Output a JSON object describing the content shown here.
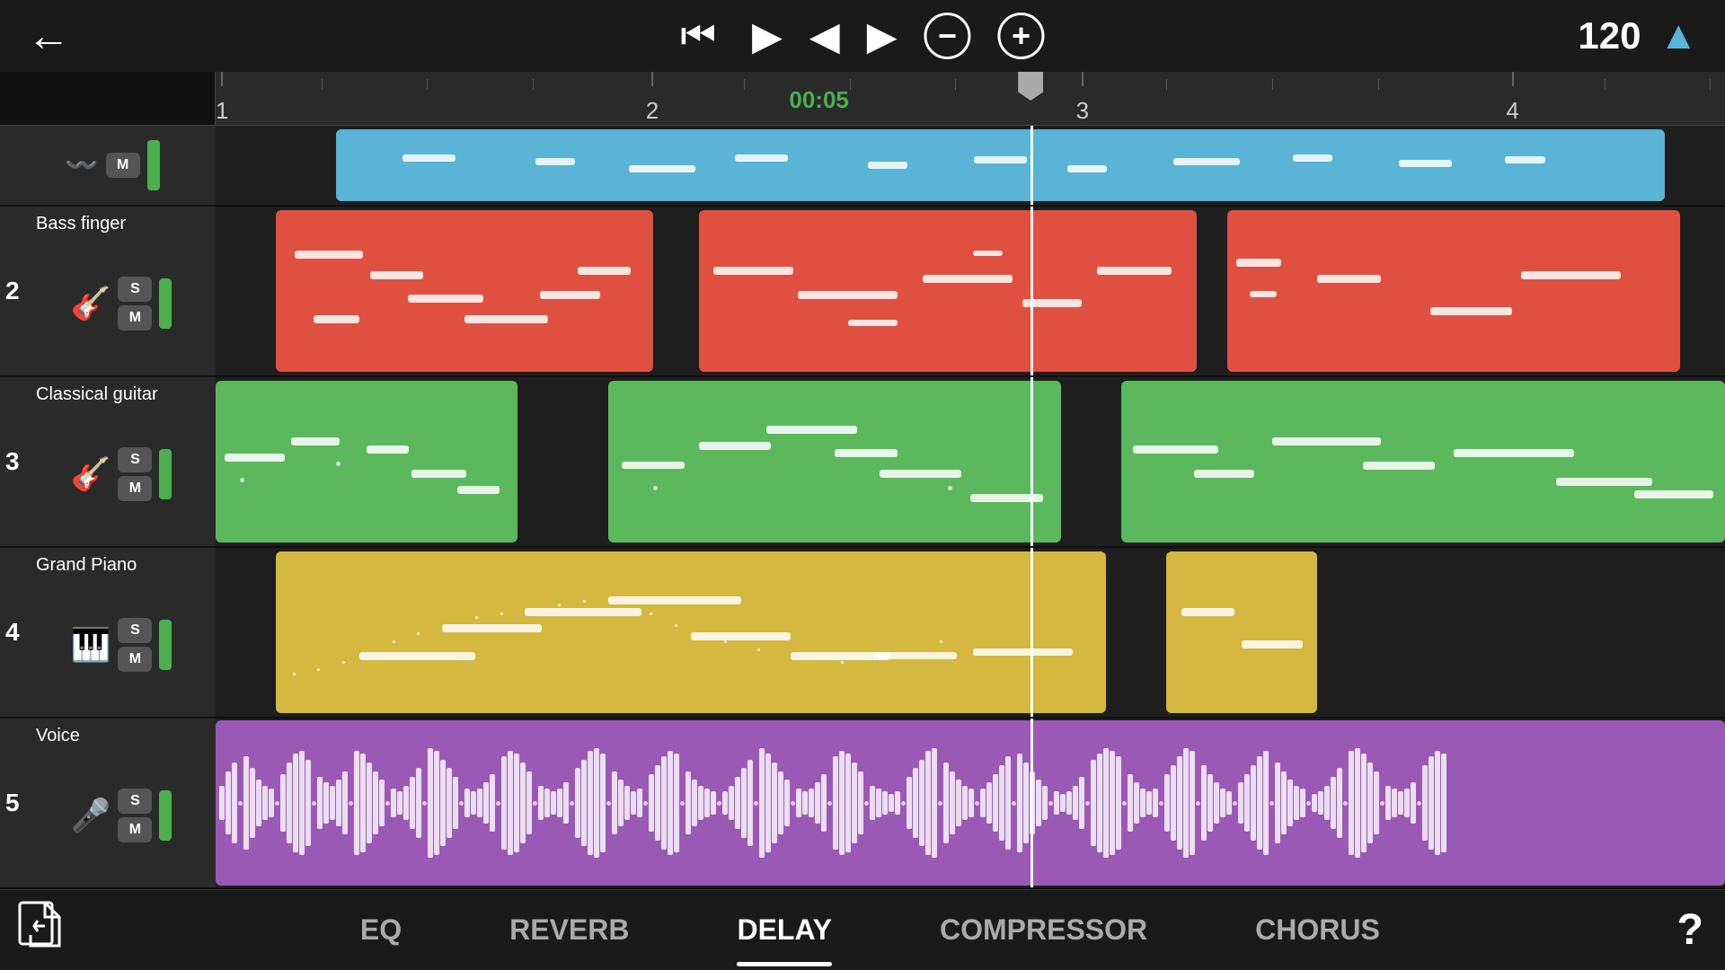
{
  "header": {
    "back_label": "←",
    "bpm": "120",
    "time_display": "00:05",
    "controls": {
      "rewind": "⏮",
      "play": "▶",
      "prev": "◀",
      "next": "▶",
      "zoom_out": "−",
      "zoom_in": "+"
    }
  },
  "ruler": {
    "marks": [
      {
        "label": "1",
        "pos_pct": 0
      },
      {
        "label": "2",
        "pos_pct": 28.5
      },
      {
        "label": "3",
        "pos_pct": 57
      },
      {
        "label": "4",
        "pos_pct": 85.5
      }
    ],
    "time_display": "00:05",
    "time_pos_pct": 42
  },
  "tracks": [
    {
      "id": 1,
      "number": "",
      "name": "",
      "icon": "〰",
      "color": "#5ab4d6",
      "clips": [
        {
          "left_pct": 8,
          "width_pct": 88
        }
      ]
    },
    {
      "id": 2,
      "number": "2",
      "name": "Bass finger",
      "icon": "🎸",
      "color": "#e05040",
      "clips": [
        {
          "left_pct": 4,
          "width_pct": 25
        },
        {
          "left_pct": 32,
          "width_pct": 33
        },
        {
          "left_pct": 67,
          "width_pct": 30
        }
      ]
    },
    {
      "id": 3,
      "number": "3",
      "name": "Classical guitar",
      "icon": "🎸",
      "color": "#5cb85c",
      "clips": [
        {
          "left_pct": 0,
          "width_pct": 20
        },
        {
          "left_pct": 26,
          "width_pct": 30
        },
        {
          "left_pct": 60,
          "width_pct": 40
        }
      ]
    },
    {
      "id": 4,
      "number": "4",
      "name": "Grand Piano",
      "icon": "🎹",
      "color": "#d4b840",
      "clips": [
        {
          "left_pct": 4,
          "width_pct": 55
        },
        {
          "left_pct": 63,
          "width_pct": 10
        }
      ]
    },
    {
      "id": 5,
      "number": "5",
      "name": "Voice",
      "icon": "🎤",
      "color": "#9b59b6",
      "clips": [
        {
          "left_pct": 0,
          "width_pct": 100
        }
      ]
    }
  ],
  "bottom_bar": {
    "import_icon": "📄",
    "tabs": [
      {
        "label": "EQ",
        "active": false
      },
      {
        "label": "REVERB",
        "active": false
      },
      {
        "label": "DELAY",
        "active": true
      },
      {
        "label": "COMPRESSOR",
        "active": false
      },
      {
        "label": "CHORUS",
        "active": false
      }
    ],
    "help_label": "?"
  }
}
